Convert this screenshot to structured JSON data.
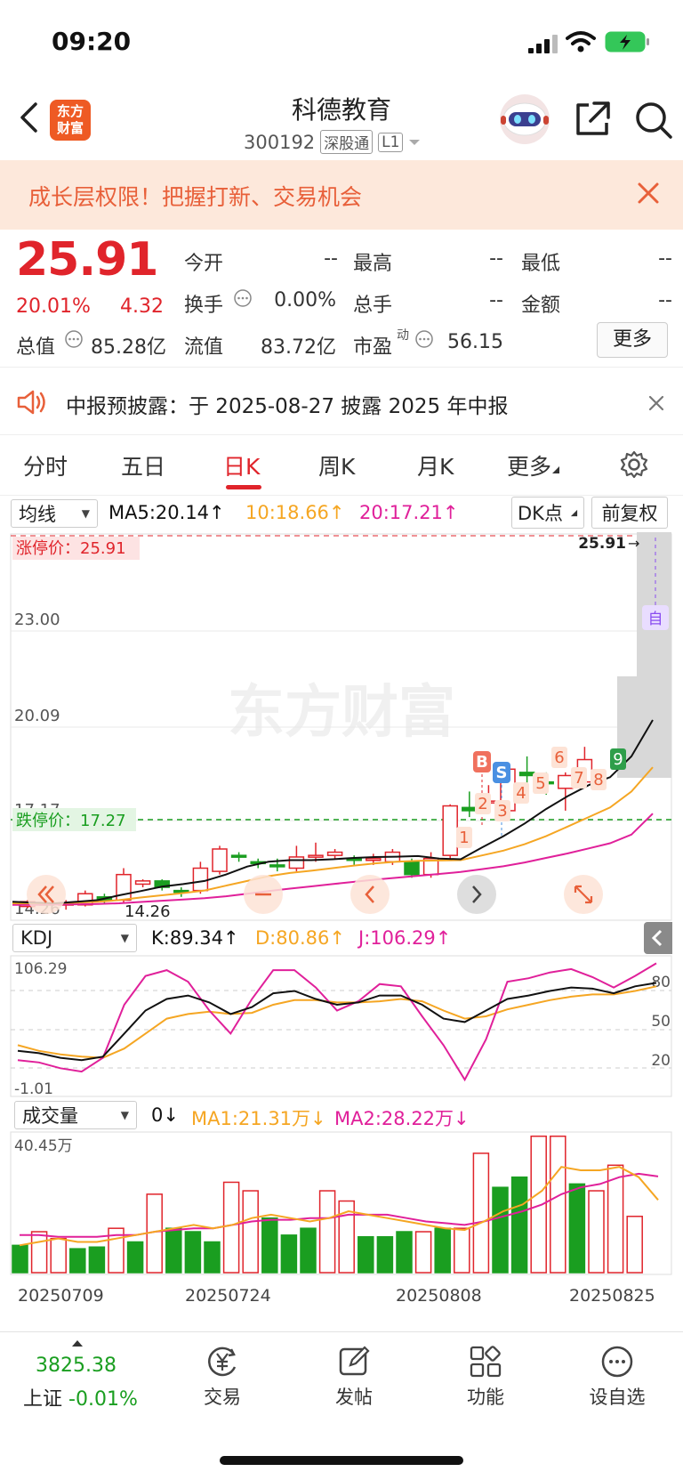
{
  "status_bar": {
    "time": "09:20"
  },
  "header": {
    "logo_text_1": "东方",
    "logo_text_2": "财富",
    "stock_name": "科德教育",
    "stock_code": "300192",
    "tag_connect": "深股通",
    "tag_level": "L1"
  },
  "banner": {
    "text": "成长层权限！把握打新、交易机会"
  },
  "quote": {
    "price": "25.91",
    "change_pct": "20.01%",
    "change_amt": "4.32",
    "open_label": "今开",
    "open_value": "--",
    "high_label": "最高",
    "high_value": "--",
    "low_label": "最低",
    "low_value": "--",
    "turnover_label": "换手",
    "turnover_value": "0.00%",
    "volume_label": "总手",
    "volume_value": "--",
    "amount_label": "金额",
    "amount_value": "--",
    "mktcap_label": "总值",
    "mktcap_value": "85.28亿",
    "float_label": "流值",
    "float_value": "83.72亿",
    "pe_label": "市盈",
    "pe_sup": "动",
    "pe_value": "56.15",
    "more_button": "更多"
  },
  "notice": {
    "text": "中报预披露：于 2025-08-27 披露 2025 年中报"
  },
  "tabs": [
    {
      "label": "分时"
    },
    {
      "label": "五日"
    },
    {
      "label": "日K"
    },
    {
      "label": "周K"
    },
    {
      "label": "月K"
    },
    {
      "label": "更多"
    }
  ],
  "ma_row": {
    "selector": "均线",
    "ma5": "MA5:20.14",
    "ma10": "10:18.66",
    "ma20": "20:17.21",
    "dk_button": "DK点",
    "adjust_button": "前复权"
  },
  "kdj_row": {
    "selector": "KDJ",
    "k": "K:89.34",
    "d": "D:80.86",
    "j": "J:106.29"
  },
  "vol_row": {
    "selector": "成交量",
    "vol": "0",
    "ma1": "MA1:21.31万",
    "ma2": "MA2:28.22万"
  },
  "colors": {
    "up": "#e0242b",
    "down": "#1a9e20",
    "ma5": "#111111",
    "ma10": "#f5a623",
    "ma20": "#e0209a",
    "banner_text": "#e8603a"
  },
  "chart_data": {
    "type": "candlestick",
    "price_labels": [
      "25.91",
      "23.00",
      "20.09",
      "17.17",
      "14.26"
    ],
    "limit_up_label": "涨停价：25.91",
    "limit_down_label": "跌停价：17.27",
    "last_price_tag": "25.91",
    "limit_up_marker": "自",
    "signal_B": "B",
    "signal_S": "S",
    "sequence_numbers": [
      "1",
      "2",
      "3",
      "4",
      "5",
      "6",
      "7",
      "8",
      "9"
    ],
    "watermark": "东方财富",
    "kdj_axis": [
      "106.29",
      "-1.01"
    ],
    "kdj_right_ticks": [
      "80",
      "50",
      "20"
    ],
    "vol_axis": "40.45万",
    "dates": [
      "20250709",
      "20250724",
      "20250808",
      "20250825"
    ],
    "candles": [
      {
        "o": 14.3,
        "c": 14.45,
        "h": 14.5,
        "l": 14.25
      },
      {
        "o": 14.4,
        "c": 14.35,
        "h": 14.45,
        "l": 14.28
      },
      {
        "o": 14.4,
        "c": 14.4,
        "h": 14.5,
        "l": 14.2
      },
      {
        "o": 14.35,
        "c": 14.7,
        "h": 14.8,
        "l": 14.3
      },
      {
        "o": 14.6,
        "c": 14.5,
        "h": 14.7,
        "l": 14.4
      },
      {
        "o": 14.5,
        "c": 15.3,
        "h": 15.5,
        "l": 14.4
      },
      {
        "o": 15.0,
        "c": 15.1,
        "h": 15.15,
        "l": 14.9
      },
      {
        "o": 15.1,
        "c": 14.9,
        "h": 15.15,
        "l": 14.8
      },
      {
        "o": 14.8,
        "c": 14.75,
        "h": 14.9,
        "l": 14.6
      },
      {
        "o": 14.8,
        "c": 15.5,
        "h": 15.7,
        "l": 14.7
      },
      {
        "o": 15.4,
        "c": 16.1,
        "h": 16.2,
        "l": 15.3
      },
      {
        "o": 15.9,
        "c": 15.85,
        "h": 16.0,
        "l": 15.7
      },
      {
        "o": 15.7,
        "c": 15.65,
        "h": 15.8,
        "l": 15.5
      },
      {
        "o": 15.6,
        "c": 15.55,
        "h": 15.8,
        "l": 15.4
      },
      {
        "o": 15.5,
        "c": 15.85,
        "h": 16.2,
        "l": 15.4
      },
      {
        "o": 15.9,
        "c": 15.9,
        "h": 16.3,
        "l": 15.7
      },
      {
        "o": 15.9,
        "c": 16.0,
        "h": 16.1,
        "l": 15.8
      },
      {
        "o": 15.8,
        "c": 15.75,
        "h": 15.9,
        "l": 15.6
      },
      {
        "o": 15.8,
        "c": 15.8,
        "h": 15.95,
        "l": 15.6
      },
      {
        "o": 15.7,
        "c": 16.0,
        "h": 16.1,
        "l": 15.6
      },
      {
        "o": 15.7,
        "c": 15.3,
        "h": 15.8,
        "l": 15.2
      },
      {
        "o": 15.3,
        "c": 15.8,
        "h": 16.0,
        "l": 15.2
      },
      {
        "o": 15.9,
        "c": 17.45,
        "h": 17.5,
        "l": 15.8
      },
      {
        "o": 17.4,
        "c": 17.3,
        "h": 17.9,
        "l": 17.1
      },
      {
        "o": 17.6,
        "c": 17.6,
        "h": 18.1,
        "l": 17.3
      },
      {
        "o": 17.3,
        "c": 18.6,
        "h": 18.7,
        "l": 17.3
      },
      {
        "o": 18.5,
        "c": 18.4,
        "h": 19.0,
        "l": 18.1
      },
      {
        "o": 18.2,
        "c": 18.15,
        "h": 18.5,
        "l": 17.8
      },
      {
        "o": 18.0,
        "c": 18.4,
        "h": 18.5,
        "l": 17.3
      },
      {
        "o": 18.2,
        "c": 18.9,
        "h": 19.3,
        "l": 18.0
      }
    ],
    "ma5": [
      14.45,
      14.42,
      14.4,
      14.45,
      14.5,
      14.65,
      14.78,
      14.92,
      15.0,
      15.1,
      15.3,
      15.55,
      15.7,
      15.75,
      15.75,
      15.78,
      15.82,
      15.85,
      15.86,
      15.88,
      15.8,
      15.78,
      16.15,
      16.5,
      16.9,
      17.35,
      17.75,
      18.1,
      18.35,
      19.0,
      20.14
    ],
    "ma10": [
      14.4,
      14.4,
      14.4,
      14.42,
      14.45,
      14.5,
      14.58,
      14.65,
      14.72,
      14.8,
      14.95,
      15.1,
      15.25,
      15.35,
      15.42,
      15.5,
      15.58,
      15.65,
      15.7,
      15.73,
      15.74,
      15.75,
      15.9,
      16.05,
      16.25,
      16.5,
      16.8,
      17.1,
      17.4,
      17.9,
      18.66
    ],
    "ma20": [
      14.35,
      14.35,
      14.36,
      14.37,
      14.38,
      14.4,
      14.44,
      14.48,
      14.52,
      14.56,
      14.62,
      14.7,
      14.78,
      14.86,
      14.93,
      15.0,
      15.07,
      15.14,
      15.2,
      15.26,
      15.32,
      15.38,
      15.47,
      15.56,
      15.68,
      15.82,
      15.96,
      16.12,
      16.28,
      16.55,
      17.21
    ],
    "kdj_k": [
      30,
      28,
      24,
      22,
      25,
      45,
      65,
      75,
      78,
      72,
      62,
      68,
      80,
      82,
      75,
      70,
      72,
      78,
      78,
      70,
      58,
      55,
      65,
      75,
      78,
      82,
      85,
      84,
      80,
      86,
      89
    ],
    "kdj_d": [
      35,
      30,
      27,
      25,
      24,
      32,
      45,
      58,
      62,
      64,
      62,
      63,
      70,
      74,
      74,
      72,
      72,
      73,
      75,
      73,
      65,
      58,
      60,
      66,
      70,
      74,
      77,
      79,
      79,
      82,
      86
    ],
    "kdj_j": [
      22,
      20,
      15,
      12,
      24,
      70,
      95,
      100,
      90,
      65,
      45,
      75,
      100,
      100,
      85,
      65,
      73,
      88,
      86,
      60,
      35,
      5,
      40,
      90,
      93,
      98,
      101,
      94,
      85,
      95,
      106
    ],
    "volume": [
      {
        "v": 8,
        "up": false
      },
      {
        "v": 12,
        "up": true
      },
      {
        "v": 10,
        "up": true
      },
      {
        "v": 7,
        "up": false
      },
      {
        "v": 7.5,
        "up": false
      },
      {
        "v": 13,
        "up": true
      },
      {
        "v": 9,
        "up": false
      },
      {
        "v": 23,
        "up": true
      },
      {
        "v": 13,
        "up": false
      },
      {
        "v": 12,
        "up": false
      },
      {
        "v": 9,
        "up": false
      },
      {
        "v": 26.5,
        "up": true
      },
      {
        "v": 24,
        "up": true
      },
      {
        "v": 16,
        "up": false
      },
      {
        "v": 11,
        "up": false
      },
      {
        "v": 13,
        "up": false
      },
      {
        "v": 24,
        "up": true
      },
      {
        "v": 21,
        "up": true
      },
      {
        "v": 10.5,
        "up": false
      },
      {
        "v": 10.5,
        "up": false
      },
      {
        "v": 12,
        "up": false
      },
      {
        "v": 12,
        "up": true
      },
      {
        "v": 13,
        "up": false
      },
      {
        "v": 13,
        "up": true
      },
      {
        "v": 35,
        "up": true
      },
      {
        "v": 25,
        "up": false
      },
      {
        "v": 28,
        "up": false
      },
      {
        "v": 40,
        "up": true
      },
      {
        "v": 40,
        "up": true
      },
      {
        "v": 26,
        "up": false
      },
      {
        "v": 24,
        "up": true
      },
      {
        "v": 31.5,
        "up": true
      },
      {
        "v": 16.5,
        "up": true
      }
    ],
    "vol_ma1": [
      8,
      9,
      10,
      9,
      9,
      10,
      11,
      12,
      13,
      14,
      13,
      14,
      16,
      17,
      16,
      15,
      16,
      18,
      17,
      16,
      15,
      14,
      13,
      12.5,
      15,
      18,
      20,
      24,
      31,
      30,
      30,
      31,
      28,
      21.31
    ],
    "vol_ma2": [
      11,
      11,
      10.5,
      10.5,
      10.5,
      11,
      11,
      12,
      12.5,
      13,
      13,
      14,
      15,
      15.5,
      15.5,
      16,
      16,
      17,
      17,
      17,
      16,
      15,
      14.5,
      14,
      15,
      16.5,
      18,
      20,
      23,
      25,
      26,
      28,
      29,
      28.22
    ]
  }
}
